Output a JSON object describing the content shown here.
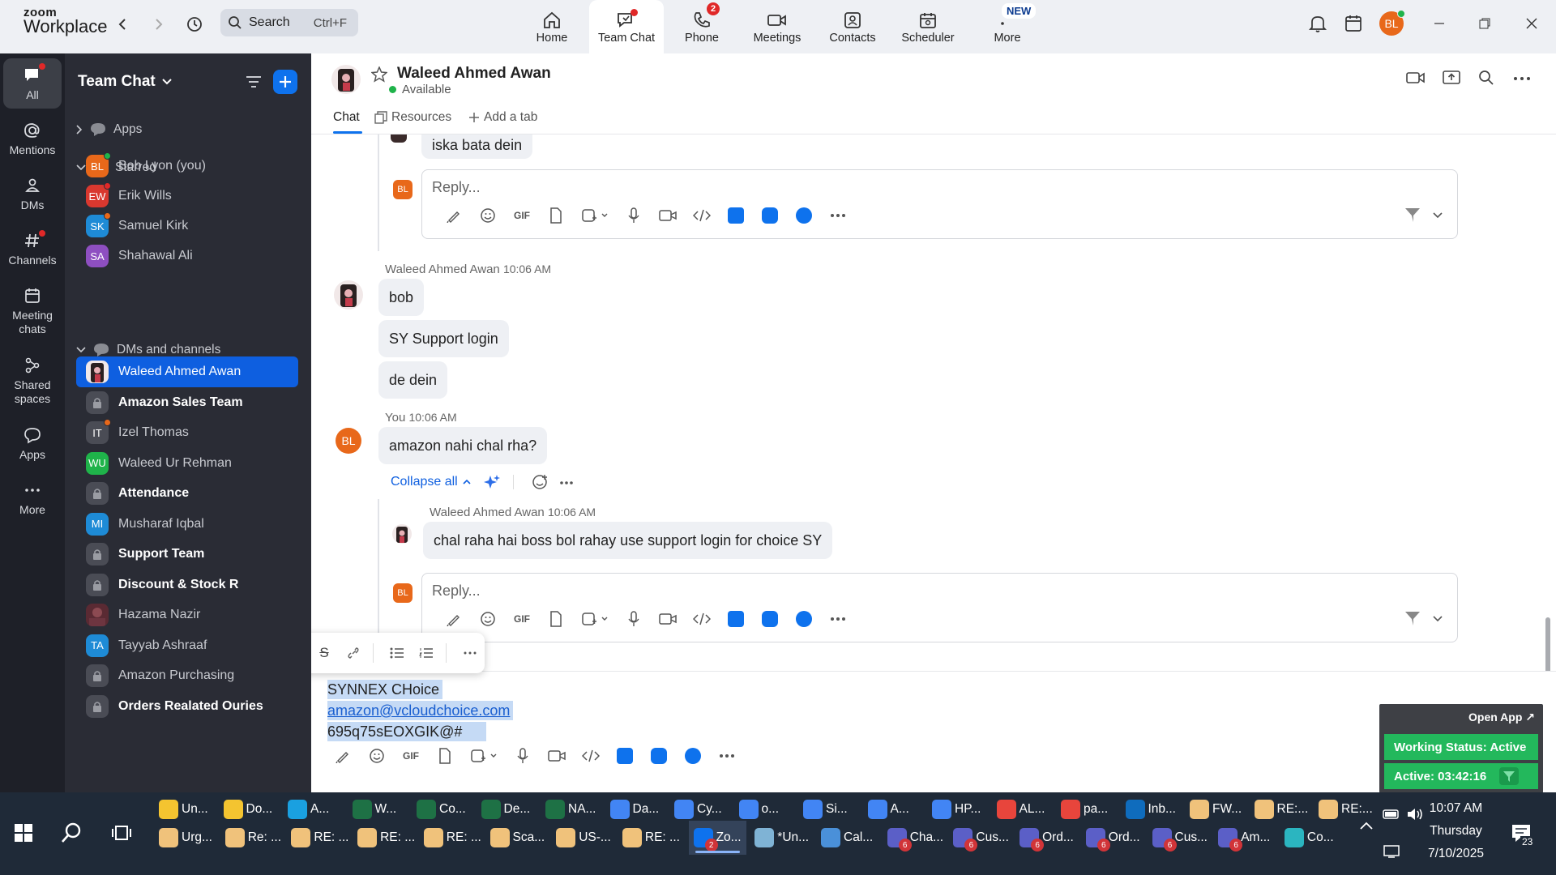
{
  "app": {
    "brand_top": "zoom",
    "brand_bottom": "Workplace"
  },
  "search": {
    "label": "Search",
    "shortcut": "Ctrl+F"
  },
  "tabs": [
    {
      "label": "Home",
      "icon": "home-icon"
    },
    {
      "label": "Team Chat",
      "icon": "chat-icon"
    },
    {
      "label": "Phone",
      "icon": "phone-icon",
      "badge": "2"
    },
    {
      "label": "Meetings",
      "icon": "video-icon"
    },
    {
      "label": "Contacts",
      "icon": "contacts-icon"
    },
    {
      "label": "Scheduler",
      "icon": "calendar-icon"
    },
    {
      "label": "More",
      "icon": "more-icon",
      "pill": "NEW"
    }
  ],
  "user": {
    "initials": "BL",
    "color": "#e8681a"
  },
  "rail": [
    {
      "label": "All"
    },
    {
      "label": "Mentions"
    },
    {
      "label": "DMs"
    },
    {
      "label": "Channels"
    },
    {
      "label": "Meeting chats"
    },
    {
      "label": "Shared spaces"
    },
    {
      "label": "Apps"
    },
    {
      "label": "More"
    }
  ],
  "sidebar": {
    "title": "Team Chat",
    "apps_label": "Apps",
    "starred_label": "Starred",
    "starred": [
      {
        "name": "Bob Lyon (you)",
        "initials": "BL",
        "color": "#e8681a",
        "presence": "#1fb34a"
      },
      {
        "name": "Erik Wills",
        "initials": "EW",
        "color": "#d9382f",
        "presence": "#e02828"
      },
      {
        "name": "Samuel Kirk",
        "initials": "SK",
        "color": "#1e8bd6",
        "presence": "#e8681a"
      },
      {
        "name": "Shahawal Ali",
        "initials": "SA",
        "color": "#8e4fc1",
        "presence": ""
      }
    ],
    "dms_label": "DMs and channels",
    "dms": [
      {
        "name": "Waleed Ahmed Awan",
        "type": "photo",
        "bold": false,
        "active": true
      },
      {
        "name": "Amazon Sales Team",
        "type": "lock",
        "bold": true
      },
      {
        "name": "Izel Thomas",
        "initials": "IT",
        "color": "#4a4c55",
        "presence": "#e8681a"
      },
      {
        "name": "Waleed Ur Rehman",
        "initials": "WU",
        "color": "#1fb34a",
        "presence": ""
      },
      {
        "name": "Attendance",
        "type": "lock",
        "bold": true
      },
      {
        "name": "Musharaf Iqbal",
        "initials": "MI",
        "color": "#1e8bd6",
        "presence": ""
      },
      {
        "name": "Support Team",
        "type": "lock",
        "bold": true
      },
      {
        "name": "Discount & Stock R",
        "type": "lock",
        "bold": true
      },
      {
        "name": "Hazama Nazir",
        "type": "photo2",
        "bold": false
      },
      {
        "name": "Tayyab Ashraaf",
        "initials": "TA",
        "color": "#1e8bd6",
        "presence": ""
      },
      {
        "name": "Amazon Purchasing",
        "type": "lock",
        "bold": false
      },
      {
        "name": "Orders Realated Ouries",
        "type": "lock",
        "bold": true
      }
    ]
  },
  "chat": {
    "name": "Waleed Ahmed Awan",
    "status": "Available",
    "tabs": [
      "Chat",
      "Resources",
      "Add a tab"
    ],
    "top_bubble": "iska bata dein",
    "reply_placeholder": "Reply...",
    "gif_label": "GIF",
    "group1": {
      "sender": "Waleed Ahmed Awan",
      "time": "10:06 AM",
      "messages": [
        "bob",
        "SY Support login",
        "de dein"
      ]
    },
    "group2": {
      "sender": "You",
      "time": "10:06 AM",
      "message": "amazon nahi chal rha?"
    },
    "collapse_label": "Collapse all",
    "thread_reply": {
      "sender": "Waleed Ahmed Awan",
      "time": "10:06 AM",
      "message": "chal raha hai boss bol rahay use support login for choice SY"
    }
  },
  "composer": {
    "lines": [
      "SYNNEX CHoice",
      "amazon@vcloudchoice.com",
      "695q75sEOXGIK@#"
    ]
  },
  "widget": {
    "open_app": "Open App ↗",
    "working_status": "Working Status: Active",
    "active_timer": "Active: 03:42:16"
  },
  "taskbar": {
    "row1": [
      {
        "label": "Un...",
        "icon_color": "#f4c430"
      },
      {
        "label": "Do...",
        "icon_color": "#f4c430"
      },
      {
        "label": "A...",
        "icon_color": "#1aa0e0"
      },
      {
        "label": "W...",
        "icon_color": "#1e7145"
      },
      {
        "label": "Co...",
        "icon_color": "#1e7145"
      },
      {
        "label": "De...",
        "icon_color": "#1e7145"
      },
      {
        "label": "NA...",
        "icon_color": "#1e7145"
      },
      {
        "label": "Da...",
        "icon_color": "#4285f4"
      },
      {
        "label": "Cy...",
        "icon_color": "#4285f4"
      },
      {
        "label": "o...",
        "icon_color": "#4285f4"
      },
      {
        "label": "Si...",
        "icon_color": "#4285f4"
      },
      {
        "label": "A...",
        "icon_color": "#4285f4"
      },
      {
        "label": "HP...",
        "icon_color": "#4285f4"
      },
      {
        "label": "AL...",
        "icon_color": "#e8453c"
      },
      {
        "label": "pa...",
        "icon_color": "#e8453c"
      },
      {
        "label": "Inb...",
        "icon_color": "#0f6cbd"
      },
      {
        "label": "FW...",
        "icon_color": "#f0c27b"
      },
      {
        "label": "RE:...",
        "icon_color": "#f0c27b"
      },
      {
        "label": "RE:...",
        "icon_color": "#f0c27b"
      }
    ],
    "row2": [
      {
        "label": "Urg...",
        "icon_color": "#f0c27b"
      },
      {
        "label": "Re: ...",
        "icon_color": "#f0c27b"
      },
      {
        "label": "RE: ...",
        "icon_color": "#f0c27b"
      },
      {
        "label": "RE: ...",
        "icon_color": "#f0c27b"
      },
      {
        "label": "RE: ...",
        "icon_color": "#f0c27b"
      },
      {
        "label": "Sca...",
        "icon_color": "#f0c27b"
      },
      {
        "label": "US-...",
        "icon_color": "#f0c27b"
      },
      {
        "label": "RE: ...",
        "icon_color": "#f0c27b"
      },
      {
        "label": "Zo...",
        "icon_color": "#0e72ed",
        "badge": "2"
      },
      {
        "label": "*Un...",
        "icon_color": "#7fb3d5"
      },
      {
        "label": "Cal...",
        "icon_color": "#4a90d9"
      },
      {
        "label": "Cha...",
        "icon_color": "#5b5fc7",
        "badge": "6"
      },
      {
        "label": "Cus...",
        "icon_color": "#5b5fc7",
        "badge": "6"
      },
      {
        "label": "Ord...",
        "icon_color": "#5b5fc7",
        "badge": "6"
      },
      {
        "label": "Ord...",
        "icon_color": "#5b5fc7",
        "badge": "6"
      },
      {
        "label": "Cus...",
        "icon_color": "#5b5fc7",
        "badge": "6"
      },
      {
        "label": "Am...",
        "icon_color": "#5b5fc7",
        "badge": "6"
      },
      {
        "label": "Co...",
        "icon_color": "#2bb5c0"
      }
    ],
    "time": "10:07 AM",
    "day": "Thursday",
    "date": "7/10/2025",
    "notif_count": "23"
  }
}
